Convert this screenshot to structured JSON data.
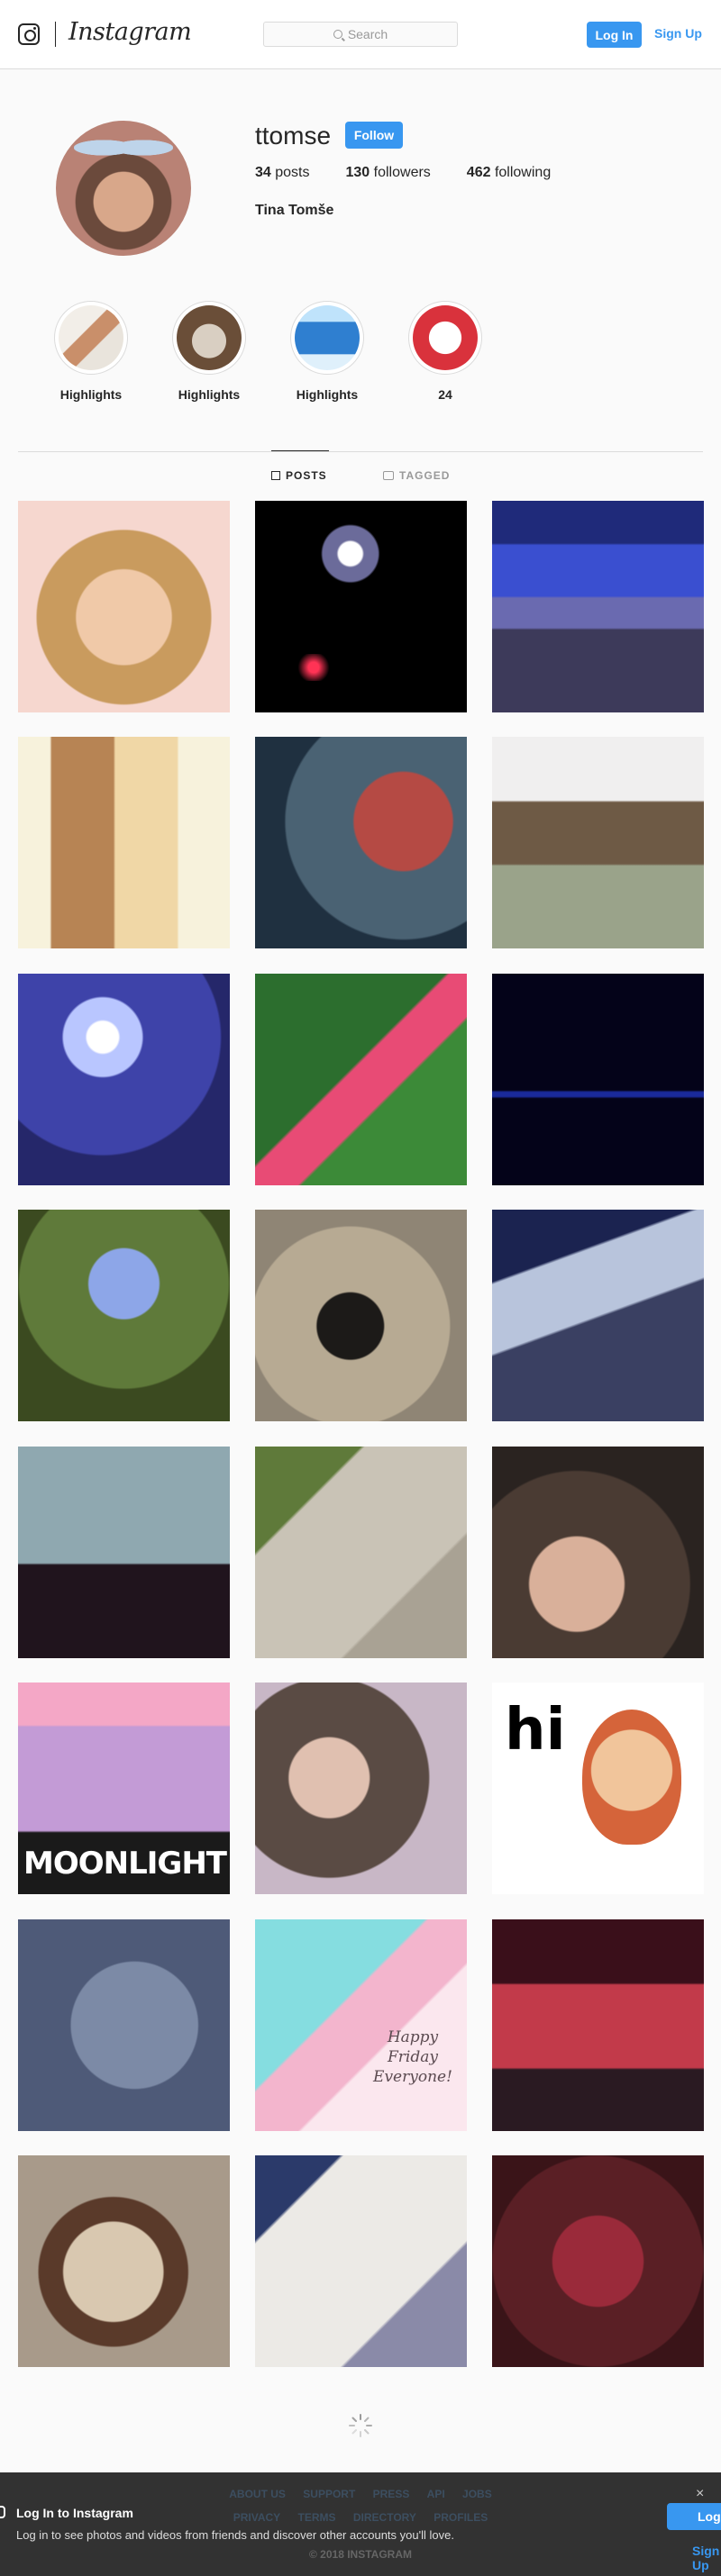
{
  "nav": {
    "wordmark": "Instagram",
    "search_placeholder": "Search",
    "login_label": "Log In",
    "signup_label": "Sign Up"
  },
  "profile": {
    "username": "ttomse",
    "follow_label": "Follow",
    "posts_count": "34",
    "posts_label": "posts",
    "followers_count": "130",
    "followers_label": "followers",
    "following_count": "462",
    "following_label": "following",
    "full_name": "Tina Tomše"
  },
  "highlights": [
    {
      "label": "Highlights"
    },
    {
      "label": "Highlights"
    },
    {
      "label": "Highlights"
    },
    {
      "label": "24"
    }
  ],
  "tabs": {
    "posts_label": "POSTS",
    "tagged_label": "TAGGED"
  },
  "posts": [
    {
      "text": ""
    },
    {
      "text": ""
    },
    {
      "text": ""
    },
    {
      "text": ""
    },
    {
      "text": ""
    },
    {
      "text": ""
    },
    {
      "text": ""
    },
    {
      "text": ""
    },
    {
      "text": ""
    },
    {
      "text": ""
    },
    {
      "text": ""
    },
    {
      "text": ""
    },
    {
      "text": ""
    },
    {
      "text": ""
    },
    {
      "text": ""
    },
    {
      "text": "MOONLIGHT"
    },
    {
      "text": ""
    },
    {
      "text": "hi"
    },
    {
      "text": ""
    },
    {
      "text": "Happy Friday Everyone!"
    },
    {
      "text": ""
    },
    {
      "text": ""
    },
    {
      "text": ""
    },
    {
      "text": ""
    }
  ],
  "footer": {
    "links_row1": [
      "ABOUT US",
      "SUPPORT",
      "PRESS",
      "API",
      "JOBS"
    ],
    "links_row2": [
      "PRIVACY",
      "TERMS",
      "DIRECTORY",
      "PROFILES"
    ],
    "copyright": "© 2018 INSTAGRAM"
  },
  "login_bar": {
    "title": "Log In to Instagram",
    "body": "Log in to see photos and videos from friends and discover other accounts you'll love.",
    "login_label": "Log In",
    "signup_label": "Sign Up",
    "close_label": "×"
  },
  "colors": {
    "accent": "#3897f0",
    "text": "#262626",
    "muted": "#999999",
    "border": "#dbdbdb"
  }
}
